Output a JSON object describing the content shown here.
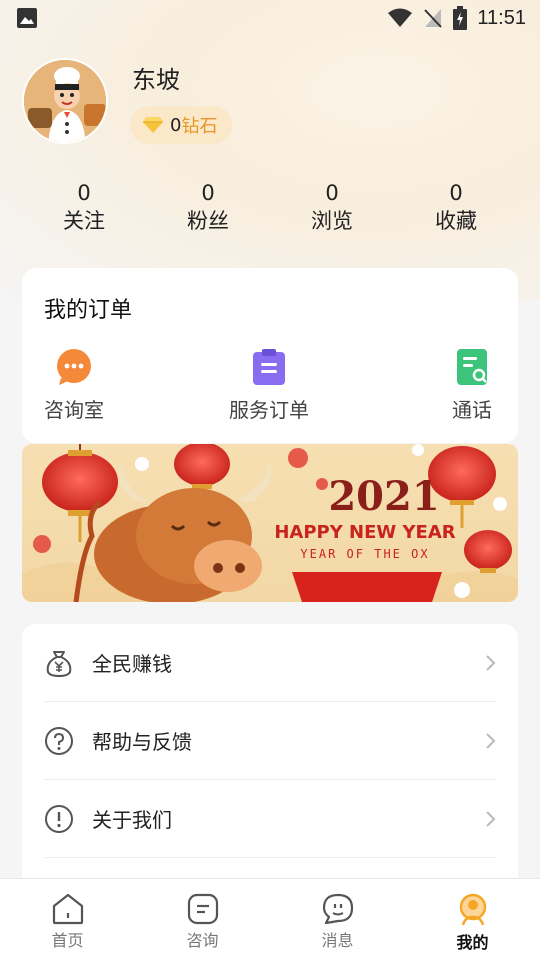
{
  "status_bar": {
    "time": "11:51"
  },
  "profile": {
    "username": "东坡",
    "diamonds": {
      "count": "0",
      "unit": "钻石"
    }
  },
  "stats": [
    {
      "value": "0",
      "label": "关注"
    },
    {
      "value": "0",
      "label": "粉丝"
    },
    {
      "value": "0",
      "label": "浏览"
    },
    {
      "value": "0",
      "label": "收藏"
    }
  ],
  "orders": {
    "title": "我的订单",
    "items": [
      {
        "label": "咨询室",
        "icon": "chat-bubble-icon",
        "color": "#f5893a"
      },
      {
        "label": "服务订单",
        "icon": "clipboard-icon",
        "color": "#8a6cf0"
      },
      {
        "label": "通话",
        "icon": "call-record-icon",
        "color": "#3cc57a"
      }
    ]
  },
  "banner": {
    "year": "2021",
    "headline": "HAPPY NEW YEAR",
    "subline": "YEAR OF THE OX"
  },
  "menu": [
    {
      "label": "全民赚钱",
      "icon": "money-bag-icon"
    },
    {
      "label": "帮助与反馈",
      "icon": "help-icon"
    },
    {
      "label": "关于我们",
      "icon": "info-icon"
    }
  ],
  "tabbar": [
    {
      "label": "首页",
      "icon": "home-icon",
      "active": false
    },
    {
      "label": "咨询",
      "icon": "consult-icon",
      "active": false
    },
    {
      "label": "消息",
      "icon": "message-icon",
      "active": false
    },
    {
      "label": "我的",
      "icon": "profile-icon",
      "active": true
    }
  ],
  "colors": {
    "accent": "#f5a623",
    "diamond_text": "#e8962a",
    "badge_bg": "#fbe8c8"
  }
}
